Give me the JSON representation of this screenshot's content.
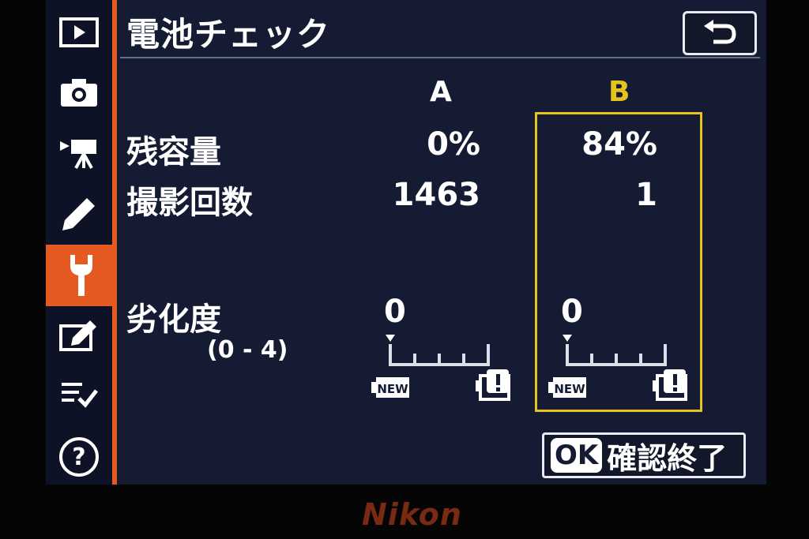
{
  "header": {
    "title": "電池チェック"
  },
  "columns": {
    "a": "A",
    "b": "B"
  },
  "rows": {
    "remaining_label": "残容量",
    "shots_label": "撮影回数",
    "degradation_label": "劣化度",
    "degradation_range": "(0 - 4)"
  },
  "battery_a": {
    "remaining": "0%",
    "shots": "1463",
    "degradation": "0"
  },
  "battery_b": {
    "remaining": "84%",
    "shots": "1",
    "degradation": "0"
  },
  "gauge": {
    "new_label": "NEW",
    "min": 0,
    "max": 4
  },
  "footer": {
    "ok_badge": "OK",
    "ok_label": "確認終了"
  },
  "brand": "Nikon",
  "sidebar": {
    "items": [
      "playback-icon",
      "camera-icon",
      "movie-icon",
      "pencil-icon",
      "wrench-icon",
      "retouch-icon",
      "my-menu-icon",
      "help-icon"
    ],
    "active": "wrench-icon"
  },
  "colors": {
    "accent": "#e45a20",
    "highlight": "#e6c21e",
    "background": "#151b33"
  }
}
